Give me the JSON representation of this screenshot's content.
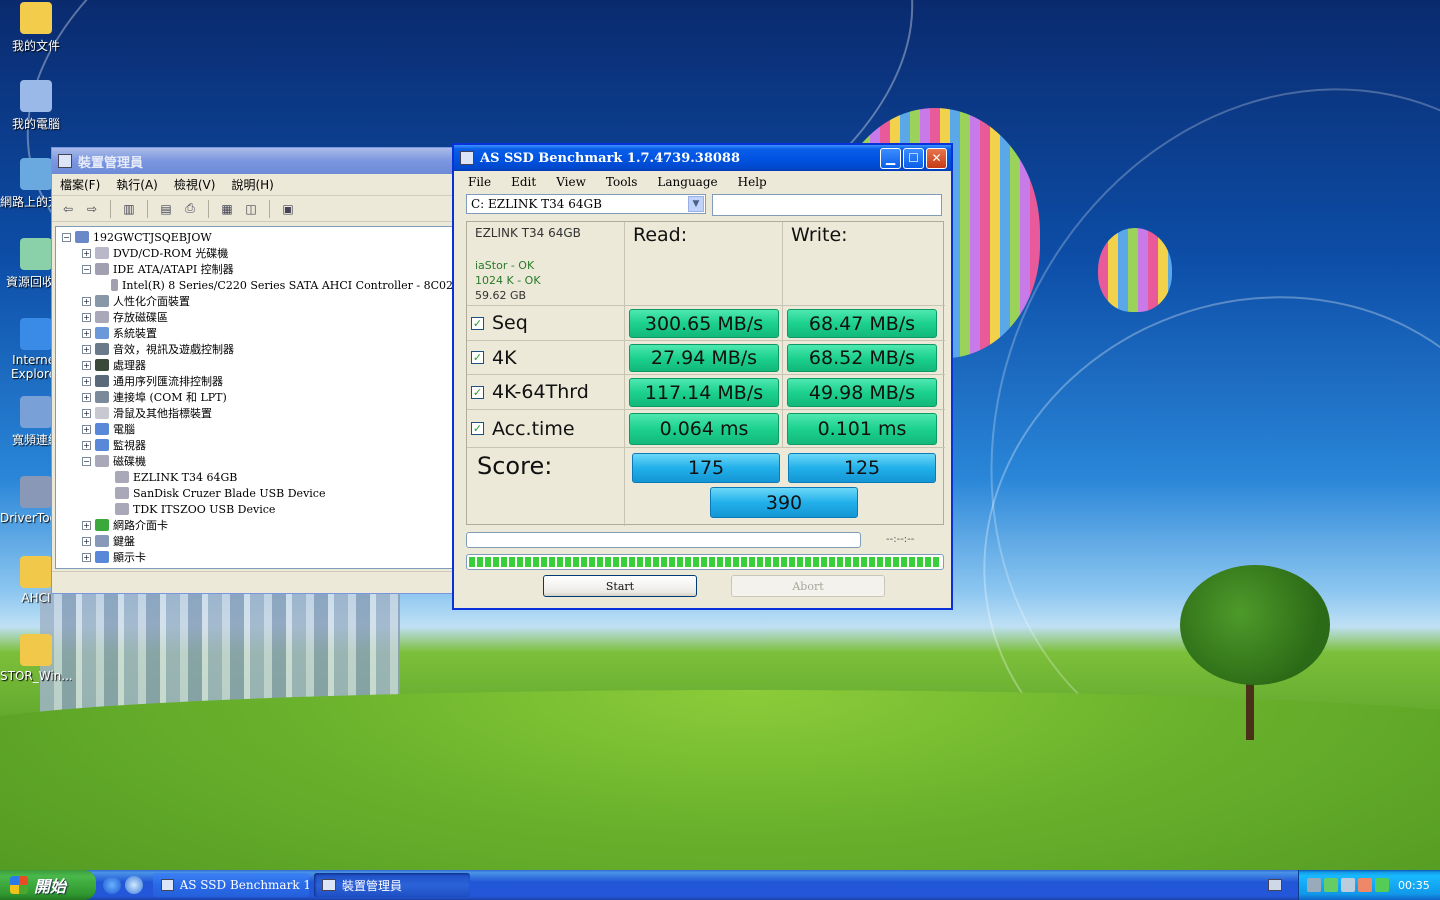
{
  "desktop": {
    "icons": [
      {
        "label": "我的文件",
        "color": "#f2cc4a"
      },
      {
        "label": "我的電腦",
        "color": "#9ab8e8"
      },
      {
        "label": "網路上的芳鄰",
        "color": "#6aa8e0"
      },
      {
        "label": "資源回收筒",
        "color": "#8ad0a8"
      },
      {
        "label": "Internet Explorer",
        "color": "#3a8ae8"
      },
      {
        "label": "寬頻連線",
        "color": "#7aa0d8"
      },
      {
        "label": "DriverToolkit",
        "color": "#8a98b8"
      },
      {
        "label": "AHCI",
        "color": "#f2c84a"
      },
      {
        "label": "STOR_Win...",
        "color": "#f2c84a"
      }
    ]
  },
  "device_manager": {
    "title": "裝置管理員",
    "menu": [
      "檔案(F)",
      "執行(A)",
      "檢視(V)",
      "說明(H)"
    ],
    "toolbar_icons": [
      "back-arrow-icon",
      "forward-arrow-icon",
      "show-hide-tree-icon",
      "properties-icon",
      "print-icon",
      "help-icon",
      "view-icon",
      "scan-hardware-icon"
    ],
    "tree": [
      {
        "label": "192GWCTJSQEBJOW",
        "level": 0,
        "expander": "−",
        "color": "#6a88c8"
      },
      {
        "label": "DVD/CD-ROM 光碟機",
        "level": 1,
        "expander": "+",
        "color": "#b8b8c8"
      },
      {
        "label": "IDE ATA/ATAPI 控制器",
        "level": 1,
        "expander": "−",
        "color": "#a0a0b0"
      },
      {
        "label": "Intel(R) 8 Series/C220 Series SATA AHCI Controller - 8C02",
        "level": 2,
        "expander": "",
        "color": "#a0a0b0"
      },
      {
        "label": "人性化介面裝置",
        "level": 1,
        "expander": "+",
        "color": "#8898a8"
      },
      {
        "label": "存放磁碟區",
        "level": 1,
        "expander": "+",
        "color": "#a8a8b8"
      },
      {
        "label": "系統裝置",
        "level": 1,
        "expander": "+",
        "color": "#6a98d8"
      },
      {
        "label": "音效，視訊及遊戲控制器",
        "level": 1,
        "expander": "+",
        "color": "#6a7a8a"
      },
      {
        "label": "處理器",
        "level": 1,
        "expander": "+",
        "color": "#3a4a3a"
      },
      {
        "label": "通用序列匯流排控制器",
        "level": 1,
        "expander": "+",
        "color": "#5a6a7a"
      },
      {
        "label": "連接埠 (COM 和 LPT)",
        "level": 1,
        "expander": "+",
        "color": "#7a8a9a"
      },
      {
        "label": "滑鼠及其他指標裝置",
        "level": 1,
        "expander": "+",
        "color": "#c8c8d0"
      },
      {
        "label": "電腦",
        "level": 1,
        "expander": "+",
        "color": "#5a88d8"
      },
      {
        "label": "監視器",
        "level": 1,
        "expander": "+",
        "color": "#5a88d8"
      },
      {
        "label": "磁碟機",
        "level": 1,
        "expander": "−",
        "color": "#a8a8b8"
      },
      {
        "label": "EZLINK T34 64GB",
        "level": 2,
        "expander": "",
        "color": "#a8a8b8"
      },
      {
        "label": "SanDisk Cruzer Blade USB Device",
        "level": 2,
        "expander": "",
        "color": "#a8a8b8"
      },
      {
        "label": "TDK ITSZOO USB Device",
        "level": 2,
        "expander": "",
        "color": "#a8a8b8"
      },
      {
        "label": "網路介面卡",
        "level": 1,
        "expander": "+",
        "color": "#3aa83a"
      },
      {
        "label": "鍵盤",
        "level": 1,
        "expander": "+",
        "color": "#8898b8"
      },
      {
        "label": "顯示卡",
        "level": 1,
        "expander": "+",
        "color": "#5a88d8"
      }
    ]
  },
  "as_ssd": {
    "title": "AS SSD Benchmark 1.7.4739.38088",
    "menu": [
      "File",
      "Edit",
      "View",
      "Tools",
      "Language",
      "Help"
    ],
    "drive_select": "C: EZLINK T34 64GB",
    "drive_info": {
      "model": "EZLINK T34 64GB",
      "driver": "iaStor - OK",
      "alignment": "1024 K - OK",
      "size": "59.62 GB"
    },
    "read_header": "Read:",
    "write_header": "Write:",
    "rows": [
      {
        "label": "Seq",
        "read": "300.65 MB/s",
        "write": "68.47 MB/s",
        "checked": "✓"
      },
      {
        "label": "4K",
        "read": "27.94 MB/s",
        "write": "68.52 MB/s",
        "checked": "✓"
      },
      {
        "label": "4K-64Thrd",
        "read": "117.14 MB/s",
        "write": "49.98 MB/s",
        "checked": "✓"
      },
      {
        "label": "Acc.time",
        "read": "0.064 ms",
        "write": "0.101 ms",
        "checked": "✓"
      }
    ],
    "score_label": "Score:",
    "score_read": "175",
    "score_write": "125",
    "score_total": "390",
    "timer": "--:--:--",
    "start_label": "Start",
    "abort_label": "Abort"
  },
  "taskbar": {
    "start_label": "開始",
    "tasks": [
      {
        "label": "AS SSD Benchmark 1....",
        "active": false
      },
      {
        "label": "裝置管理員",
        "active": true
      }
    ],
    "clock": "00:35"
  }
}
